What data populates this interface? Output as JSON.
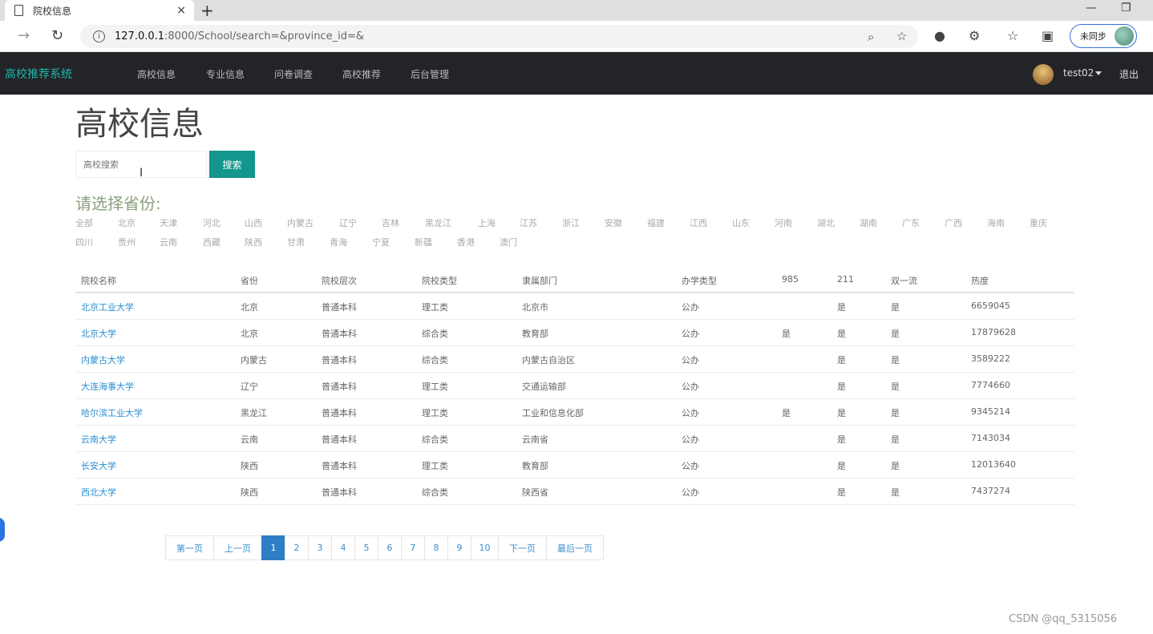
{
  "browser": {
    "tab_title": "院校信息",
    "tab_close": "×",
    "new_tab": "+",
    "url_host": "127.0.0.1",
    "url_rest": ":8000/School/search=&province_id=&",
    "sync_label": "未同步"
  },
  "nav": {
    "brand": "高校推荐系统",
    "links": [
      "高校信息",
      "专业信息",
      "问卷调查",
      "高校推荐",
      "后台管理"
    ],
    "username": "test02",
    "logout": "退出"
  },
  "page": {
    "title": "高校信息",
    "search_placeholder": "高校搜索",
    "search_button": "搜索",
    "province_heading": "请选择省份:",
    "provinces_row1": [
      "全部",
      "北京",
      "天津",
      "河北",
      "山西",
      "内蒙古",
      "辽宁",
      "吉林",
      "黑龙江",
      "上海",
      "江苏",
      "浙江",
      "安徽",
      "福建",
      "江西",
      "山东",
      "河南",
      "湖北",
      "湖南",
      "广东",
      "广西",
      "海南",
      "重庆"
    ],
    "provinces_row2": [
      "四川",
      "贵州",
      "云南",
      "西藏",
      "陕西",
      "甘肃",
      "青海",
      "宁夏",
      "新疆",
      "香港",
      "澳门"
    ]
  },
  "table": {
    "headers": [
      "院校名称",
      "省份",
      "院校层次",
      "院校类型",
      "隶属部门",
      "办学类型",
      "985",
      "211",
      "双一流",
      "热度"
    ],
    "rows": [
      [
        "北京工业大学",
        "北京",
        "普通本科",
        "理工类",
        "北京市",
        "公办",
        "",
        "是",
        "是",
        "6659045"
      ],
      [
        "北京大学",
        "北京",
        "普通本科",
        "综合类",
        "教育部",
        "公办",
        "是",
        "是",
        "是",
        "17879628"
      ],
      [
        "内蒙古大学",
        "内蒙古",
        "普通本科",
        "综合类",
        "内蒙古自治区",
        "公办",
        "",
        "是",
        "是",
        "3589222"
      ],
      [
        "大连海事大学",
        "辽宁",
        "普通本科",
        "理工类",
        "交通运输部",
        "公办",
        "",
        "是",
        "是",
        "7774660"
      ],
      [
        "哈尔滨工业大学",
        "黑龙江",
        "普通本科",
        "理工类",
        "工业和信息化部",
        "公办",
        "是",
        "是",
        "是",
        "9345214"
      ],
      [
        "云南大学",
        "云南",
        "普通本科",
        "综合类",
        "云南省",
        "公办",
        "",
        "是",
        "是",
        "7143034"
      ],
      [
        "长安大学",
        "陕西",
        "普通本科",
        "理工类",
        "教育部",
        "公办",
        "",
        "是",
        "是",
        "12013640"
      ],
      [
        "西北大学",
        "陕西",
        "普通本科",
        "综合类",
        "陕西省",
        "公办",
        "",
        "是",
        "是",
        "7437274"
      ]
    ]
  },
  "pagination": {
    "first": "第一页",
    "prev": "上一页",
    "pages": [
      "1",
      "2",
      "3",
      "4",
      "5",
      "6",
      "7",
      "8",
      "9",
      "10"
    ],
    "current": "1",
    "next": "下一页",
    "last": "最后一页"
  },
  "watermark": "CSDN @qq_5315056"
}
